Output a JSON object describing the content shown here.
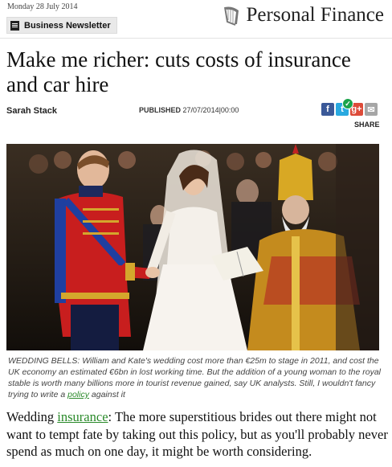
{
  "header": {
    "date": "Monday 28 July 2014",
    "newsletter_label": "Business Newsletter",
    "section_title": "Personal Finance"
  },
  "article": {
    "headline": "Make me richer: cuts costs of insurance and car hire",
    "author": "Sarah Stack",
    "published_label": "PUBLISHED",
    "published_value": "27/07/2014|00:00",
    "share_label": "SHARE",
    "caption": {
      "text_before": "WEDDING BELLS: William and Kate's wedding cost more than €25m to stage in 2011, and cost the UK economy an estimated €6bn in lost working time. But the addition of a young woman to the royal stable is worth many billions more in tourist revenue gained, say UK analysts. Still, I wouldn't fancy trying to write a ",
      "link": "policy",
      "text_after": " against it"
    },
    "body": {
      "text_before": "Wedding ",
      "link": "insurance",
      "text_after": ": The more superstitious brides out there might not want to tempt fate by taking out this policy, but as you'll probably never spend as much on one day, it might be worth considering."
    }
  },
  "share_icons": [
    {
      "name": "facebook-icon",
      "glyph": "f"
    },
    {
      "name": "twitter-icon",
      "glyph": "t"
    },
    {
      "name": "google-plus-icon",
      "glyph": "g+"
    },
    {
      "name": "email-icon",
      "glyph": "✉"
    }
  ],
  "colors": {
    "link": "#2a8a2a",
    "facebook": "#3b5998",
    "twitter": "#29a9e0",
    "google_plus": "#dd4b39"
  }
}
